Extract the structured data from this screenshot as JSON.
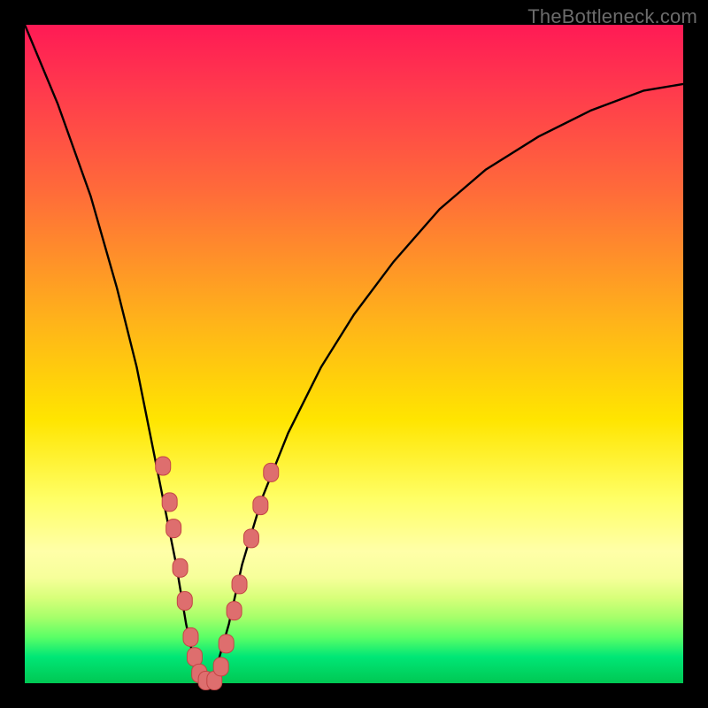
{
  "watermark": "TheBottleneck.com",
  "colors": {
    "background": "#000000",
    "curve_stroke": "#000000",
    "marker_fill": "#de6e6e",
    "marker_stroke": "#c34545"
  },
  "chart_data": {
    "type": "line",
    "title": "",
    "xlabel": "",
    "ylabel": "",
    "xlim": [
      0,
      100
    ],
    "ylim": [
      0,
      100
    ],
    "grid": false,
    "legend": false,
    "note": "V-shaped bottleneck curve. x is a normalized performance-ratio axis (0–100); y is bottleneck percentage (0 = balanced / green, 100 = severe / red). Values estimated from pixel positions.",
    "series": [
      {
        "name": "bottleneck-curve",
        "x": [
          0,
          5,
          10,
          14,
          17,
          19,
          21,
          23,
          24.5,
          26,
          27.5,
          29,
          31,
          33,
          36,
          40,
          45,
          50,
          56,
          63,
          70,
          78,
          86,
          94,
          100
        ],
        "y": [
          100,
          88,
          74,
          60,
          48,
          38,
          28,
          18,
          9,
          2,
          0,
          2,
          9,
          18,
          28,
          38,
          48,
          56,
          64,
          72,
          78,
          83,
          87,
          90,
          91
        ]
      }
    ],
    "markers": {
      "name": "highlighted-points",
      "note": "Salmon-colored rounded markers clustered near the curve minimum on both arms.",
      "points": [
        {
          "x": 21.0,
          "y": 33.0
        },
        {
          "x": 22.0,
          "y": 27.5
        },
        {
          "x": 22.6,
          "y": 23.5
        },
        {
          "x": 23.6,
          "y": 17.5
        },
        {
          "x": 24.3,
          "y": 12.5
        },
        {
          "x": 25.2,
          "y": 7.0
        },
        {
          "x": 25.8,
          "y": 4.0
        },
        {
          "x": 26.5,
          "y": 1.5
        },
        {
          "x": 27.5,
          "y": 0.4
        },
        {
          "x": 28.8,
          "y": 0.4
        },
        {
          "x": 29.8,
          "y": 2.5
        },
        {
          "x": 30.6,
          "y": 6.0
        },
        {
          "x": 31.8,
          "y": 11.0
        },
        {
          "x": 32.6,
          "y": 15.0
        },
        {
          "x": 34.4,
          "y": 22.0
        },
        {
          "x": 35.8,
          "y": 27.0
        },
        {
          "x": 37.4,
          "y": 32.0
        }
      ]
    }
  }
}
